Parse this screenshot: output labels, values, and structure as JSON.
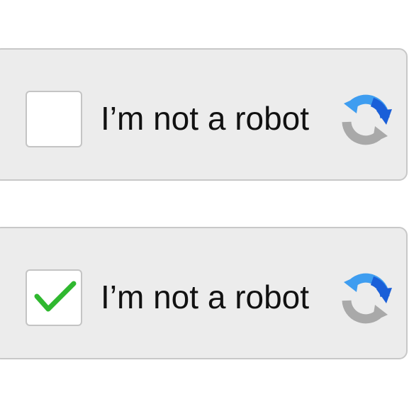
{
  "widgets": [
    {
      "label": "I’m not a robot",
      "checked": false,
      "logo_icon": "recaptcha-refresh-icon"
    },
    {
      "label": "I’m not a robot",
      "checked": true,
      "checkmark_icon": "checkmark-icon",
      "logo_icon": "recaptcha-refresh-icon"
    }
  ],
  "colors": {
    "widget_background": "#ececec",
    "widget_border": "#c8c8c8",
    "checkbox_border": "#c4c4c4",
    "checkmark": "#2fb82f",
    "logo_blue_dark": "#1a5fd8",
    "logo_blue_light": "#3e9df0",
    "logo_gray": "#a9a9a9"
  }
}
